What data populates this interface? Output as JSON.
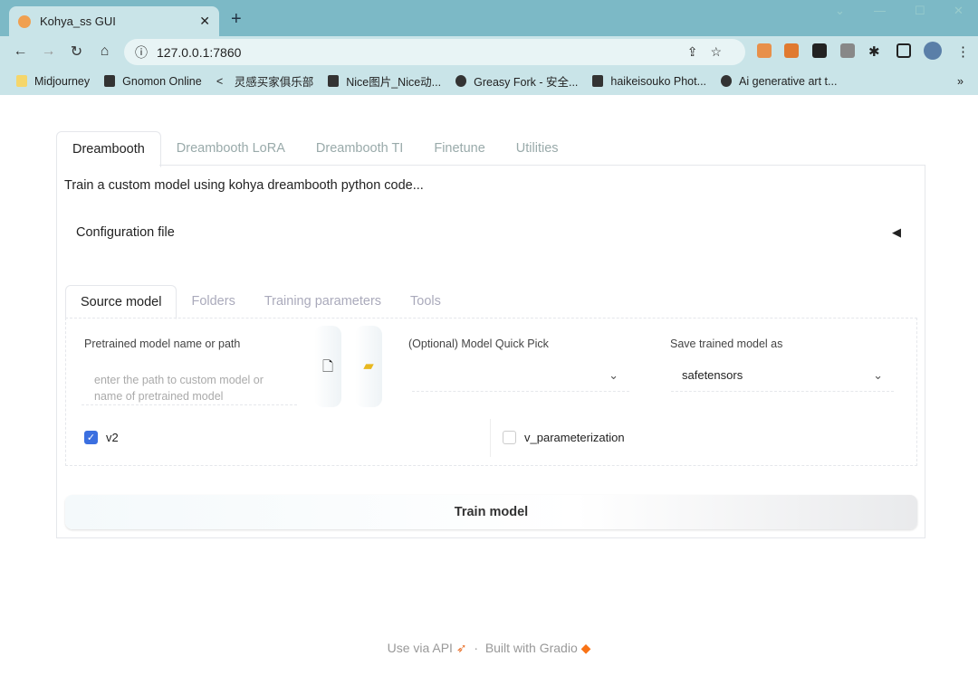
{
  "browser": {
    "tab_title": "Kohya_ss GUI",
    "url": "127.0.0.1:7860",
    "bookmarks": [
      "Midjourney",
      "Gnomon Online",
      "灵感买家俱乐部",
      "Nice图片_Nice动...",
      "Greasy Fork - 安全...",
      "haikeisouko Phot...",
      "Ai generative art t..."
    ]
  },
  "main": {
    "tabs": [
      "Dreambooth",
      "Dreambooth LoRA",
      "Dreambooth TI",
      "Finetune",
      "Utilities"
    ],
    "description": "Train a custom model using kohya dreambooth python code...",
    "config_label": "Configuration file",
    "subtabs": [
      "Source model",
      "Folders",
      "Training parameters",
      "Tools"
    ],
    "pretrained_label": "Pretrained model name or path",
    "pretrained_placeholder": "enter the path to custom model or name of pretrained model",
    "quick_pick_label": "(Optional) Model Quick Pick",
    "quick_pick_value": "",
    "save_as_label": "Save trained model as",
    "save_as_value": "safetensors",
    "v2_label": "v2",
    "v2_checked": true,
    "vparam_label": "v_parameterization",
    "vparam_checked": false,
    "train_button": "Train model"
  },
  "footer": {
    "api": "Use via API",
    "sep": "·",
    "built": "Built with Gradio"
  }
}
